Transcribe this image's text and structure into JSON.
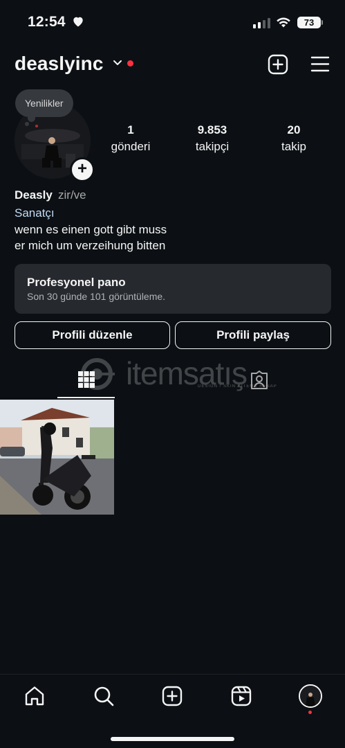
{
  "status_bar": {
    "time": "12:54",
    "battery": "73"
  },
  "header": {
    "username": "deaslyinc"
  },
  "profile": {
    "note": "Yenilikler",
    "stats": [
      {
        "value": "1",
        "label": "gönderi"
      },
      {
        "value": "9.853",
        "label": "takipçi"
      },
      {
        "value": "20",
        "label": "takip"
      }
    ],
    "name": "Deasly",
    "pronouns": "zir/ve",
    "category": "Sanatçı",
    "bio_line1": "wenn es einen gott gibt muss",
    "bio_line2": "er mich um verzeihung bitten"
  },
  "dashboard": {
    "title": "Profesyonel pano",
    "subtitle": "Son 30 günde 101 görüntüleme."
  },
  "buttons": {
    "edit": "Profili düzenle",
    "share": "Profili paylaş"
  },
  "watermark": {
    "text": "itemsatış",
    "sub": "DESIGN / SKIN / ITEM / HESAP"
  },
  "colors": {
    "background": "#0c1014",
    "notification": "#ff3040",
    "category": "#c3dcf6"
  },
  "icons": [
    "heart-icon",
    "signal-icon",
    "wifi-icon",
    "battery-icon",
    "chevron-down-icon",
    "plus-square-icon",
    "hamburger-menu-icon",
    "grid-icon",
    "tagged-icon",
    "home-icon",
    "search-icon",
    "reels-icon"
  ]
}
